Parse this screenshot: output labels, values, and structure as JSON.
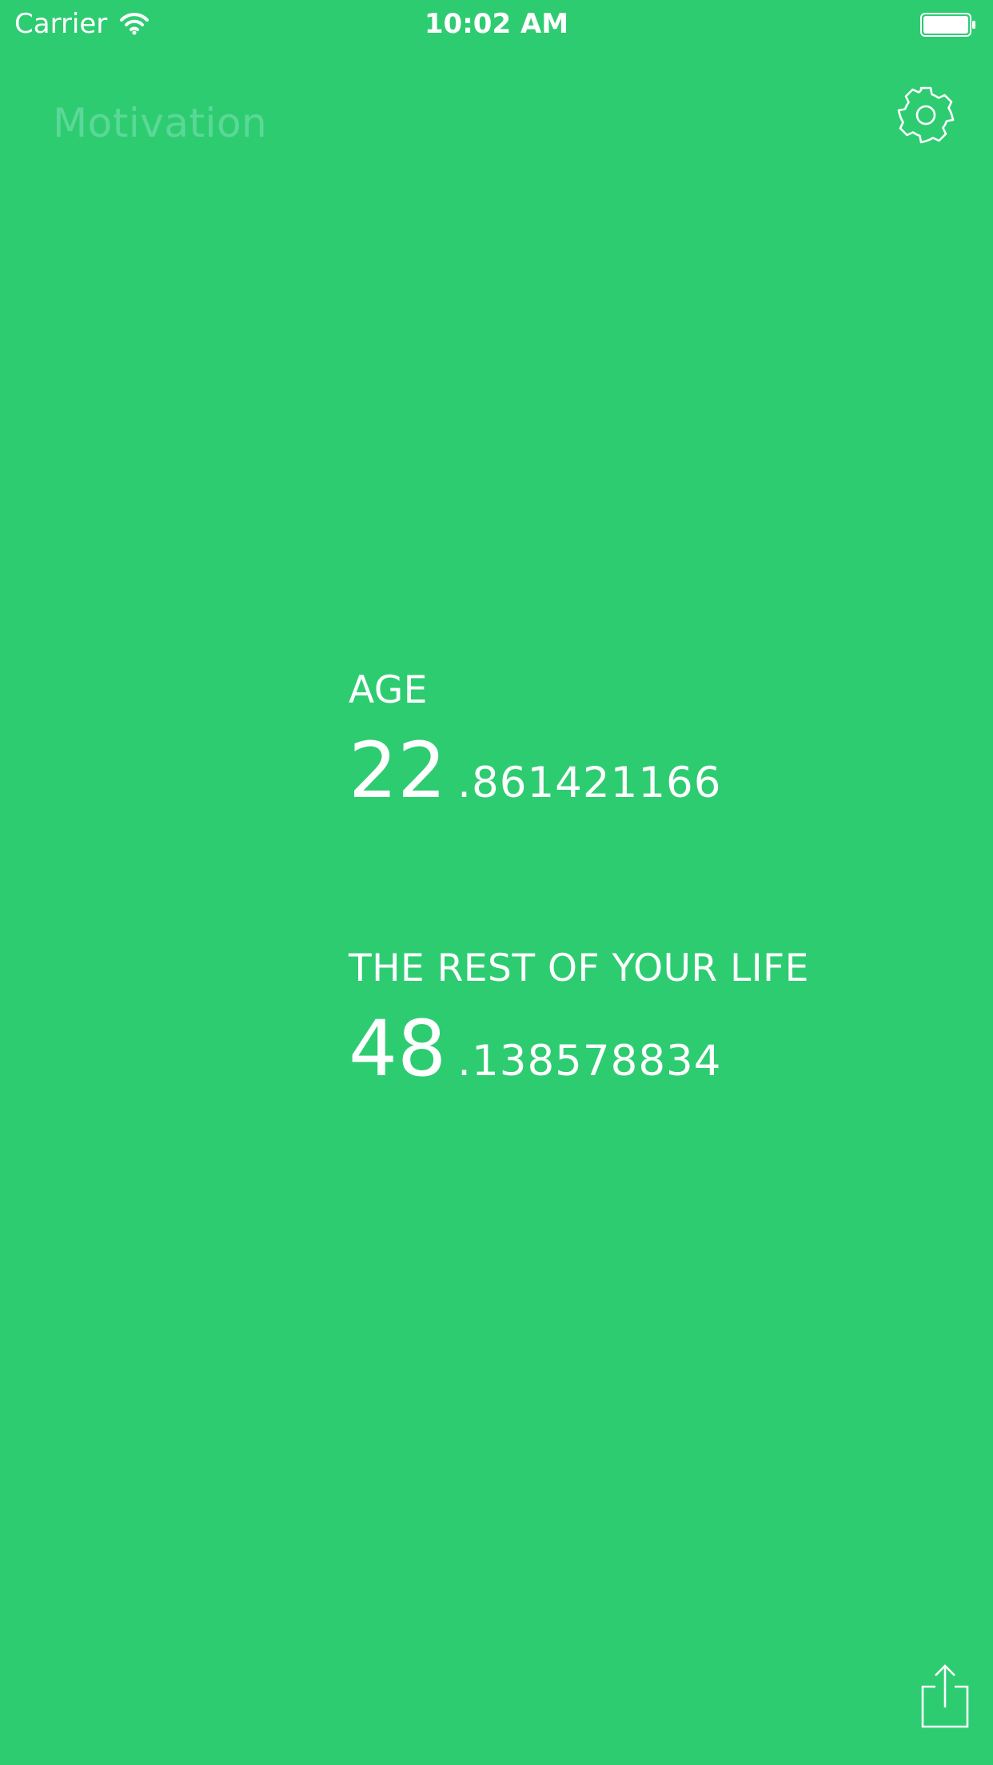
{
  "status_bar": {
    "carrier": "Carrier",
    "time": "10:02 AM"
  },
  "nav": {
    "title": "Motivation",
    "settings_icon": "gear-icon"
  },
  "stats": {
    "age": {
      "label": "AGE",
      "integer": "22",
      "fraction": ".861421166"
    },
    "rest": {
      "label": "THE REST OF YOUR LIFE",
      "integer": "48",
      "fraction": ".138578834"
    }
  },
  "toolbar": {
    "share_icon": "share-icon"
  },
  "colors": {
    "background": "#2ecc71",
    "title": "#5bd898",
    "text": "#ffffff"
  }
}
